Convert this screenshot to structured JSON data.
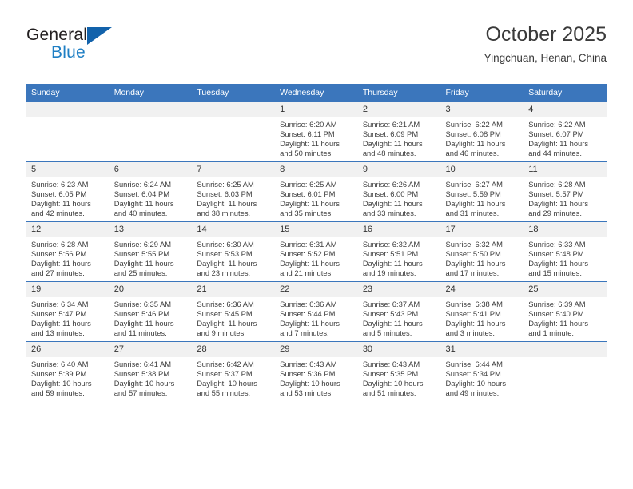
{
  "brand": {
    "name_part1": "General",
    "name_part2": "Blue",
    "triangle_color": "#1262AB",
    "blue_text_color": "#1F7FC4"
  },
  "header": {
    "title": "October 2025",
    "subtitle": "Yingchuan, Henan, China"
  },
  "theme": {
    "header_blue": "#3B76BC",
    "daynum_background": "#F1F1F1",
    "text_color": "#3D3D3D"
  },
  "weekday_headers": [
    "Sunday",
    "Monday",
    "Tuesday",
    "Wednesday",
    "Thursday",
    "Friday",
    "Saturday"
  ],
  "weeks": [
    [
      {
        "day": "",
        "sunrise": "",
        "sunset": "",
        "daylight_line1": "",
        "daylight_line2": ""
      },
      {
        "day": "",
        "sunrise": "",
        "sunset": "",
        "daylight_line1": "",
        "daylight_line2": ""
      },
      {
        "day": "",
        "sunrise": "",
        "sunset": "",
        "daylight_line1": "",
        "daylight_line2": ""
      },
      {
        "day": "1",
        "sunrise": "Sunrise: 6:20 AM",
        "sunset": "Sunset: 6:11 PM",
        "daylight_line1": "Daylight: 11 hours",
        "daylight_line2": "and 50 minutes."
      },
      {
        "day": "2",
        "sunrise": "Sunrise: 6:21 AM",
        "sunset": "Sunset: 6:09 PM",
        "daylight_line1": "Daylight: 11 hours",
        "daylight_line2": "and 48 minutes."
      },
      {
        "day": "3",
        "sunrise": "Sunrise: 6:22 AM",
        "sunset": "Sunset: 6:08 PM",
        "daylight_line1": "Daylight: 11 hours",
        "daylight_line2": "and 46 minutes."
      },
      {
        "day": "4",
        "sunrise": "Sunrise: 6:22 AM",
        "sunset": "Sunset: 6:07 PM",
        "daylight_line1": "Daylight: 11 hours",
        "daylight_line2": "and 44 minutes."
      }
    ],
    [
      {
        "day": "5",
        "sunrise": "Sunrise: 6:23 AM",
        "sunset": "Sunset: 6:05 PM",
        "daylight_line1": "Daylight: 11 hours",
        "daylight_line2": "and 42 minutes."
      },
      {
        "day": "6",
        "sunrise": "Sunrise: 6:24 AM",
        "sunset": "Sunset: 6:04 PM",
        "daylight_line1": "Daylight: 11 hours",
        "daylight_line2": "and 40 minutes."
      },
      {
        "day": "7",
        "sunrise": "Sunrise: 6:25 AM",
        "sunset": "Sunset: 6:03 PM",
        "daylight_line1": "Daylight: 11 hours",
        "daylight_line2": "and 38 minutes."
      },
      {
        "day": "8",
        "sunrise": "Sunrise: 6:25 AM",
        "sunset": "Sunset: 6:01 PM",
        "daylight_line1": "Daylight: 11 hours",
        "daylight_line2": "and 35 minutes."
      },
      {
        "day": "9",
        "sunrise": "Sunrise: 6:26 AM",
        "sunset": "Sunset: 6:00 PM",
        "daylight_line1": "Daylight: 11 hours",
        "daylight_line2": "and 33 minutes."
      },
      {
        "day": "10",
        "sunrise": "Sunrise: 6:27 AM",
        "sunset": "Sunset: 5:59 PM",
        "daylight_line1": "Daylight: 11 hours",
        "daylight_line2": "and 31 minutes."
      },
      {
        "day": "11",
        "sunrise": "Sunrise: 6:28 AM",
        "sunset": "Sunset: 5:57 PM",
        "daylight_line1": "Daylight: 11 hours",
        "daylight_line2": "and 29 minutes."
      }
    ],
    [
      {
        "day": "12",
        "sunrise": "Sunrise: 6:28 AM",
        "sunset": "Sunset: 5:56 PM",
        "daylight_line1": "Daylight: 11 hours",
        "daylight_line2": "and 27 minutes."
      },
      {
        "day": "13",
        "sunrise": "Sunrise: 6:29 AM",
        "sunset": "Sunset: 5:55 PM",
        "daylight_line1": "Daylight: 11 hours",
        "daylight_line2": "and 25 minutes."
      },
      {
        "day": "14",
        "sunrise": "Sunrise: 6:30 AM",
        "sunset": "Sunset: 5:53 PM",
        "daylight_line1": "Daylight: 11 hours",
        "daylight_line2": "and 23 minutes."
      },
      {
        "day": "15",
        "sunrise": "Sunrise: 6:31 AM",
        "sunset": "Sunset: 5:52 PM",
        "daylight_line1": "Daylight: 11 hours",
        "daylight_line2": "and 21 minutes."
      },
      {
        "day": "16",
        "sunrise": "Sunrise: 6:32 AM",
        "sunset": "Sunset: 5:51 PM",
        "daylight_line1": "Daylight: 11 hours",
        "daylight_line2": "and 19 minutes."
      },
      {
        "day": "17",
        "sunrise": "Sunrise: 6:32 AM",
        "sunset": "Sunset: 5:50 PM",
        "daylight_line1": "Daylight: 11 hours",
        "daylight_line2": "and 17 minutes."
      },
      {
        "day": "18",
        "sunrise": "Sunrise: 6:33 AM",
        "sunset": "Sunset: 5:48 PM",
        "daylight_line1": "Daylight: 11 hours",
        "daylight_line2": "and 15 minutes."
      }
    ],
    [
      {
        "day": "19",
        "sunrise": "Sunrise: 6:34 AM",
        "sunset": "Sunset: 5:47 PM",
        "daylight_line1": "Daylight: 11 hours",
        "daylight_line2": "and 13 minutes."
      },
      {
        "day": "20",
        "sunrise": "Sunrise: 6:35 AM",
        "sunset": "Sunset: 5:46 PM",
        "daylight_line1": "Daylight: 11 hours",
        "daylight_line2": "and 11 minutes."
      },
      {
        "day": "21",
        "sunrise": "Sunrise: 6:36 AM",
        "sunset": "Sunset: 5:45 PM",
        "daylight_line1": "Daylight: 11 hours",
        "daylight_line2": "and 9 minutes."
      },
      {
        "day": "22",
        "sunrise": "Sunrise: 6:36 AM",
        "sunset": "Sunset: 5:44 PM",
        "daylight_line1": "Daylight: 11 hours",
        "daylight_line2": "and 7 minutes."
      },
      {
        "day": "23",
        "sunrise": "Sunrise: 6:37 AM",
        "sunset": "Sunset: 5:43 PM",
        "daylight_line1": "Daylight: 11 hours",
        "daylight_line2": "and 5 minutes."
      },
      {
        "day": "24",
        "sunrise": "Sunrise: 6:38 AM",
        "sunset": "Sunset: 5:41 PM",
        "daylight_line1": "Daylight: 11 hours",
        "daylight_line2": "and 3 minutes."
      },
      {
        "day": "25",
        "sunrise": "Sunrise: 6:39 AM",
        "sunset": "Sunset: 5:40 PM",
        "daylight_line1": "Daylight: 11 hours",
        "daylight_line2": "and 1 minute."
      }
    ],
    [
      {
        "day": "26",
        "sunrise": "Sunrise: 6:40 AM",
        "sunset": "Sunset: 5:39 PM",
        "daylight_line1": "Daylight: 10 hours",
        "daylight_line2": "and 59 minutes."
      },
      {
        "day": "27",
        "sunrise": "Sunrise: 6:41 AM",
        "sunset": "Sunset: 5:38 PM",
        "daylight_line1": "Daylight: 10 hours",
        "daylight_line2": "and 57 minutes."
      },
      {
        "day": "28",
        "sunrise": "Sunrise: 6:42 AM",
        "sunset": "Sunset: 5:37 PM",
        "daylight_line1": "Daylight: 10 hours",
        "daylight_line2": "and 55 minutes."
      },
      {
        "day": "29",
        "sunrise": "Sunrise: 6:43 AM",
        "sunset": "Sunset: 5:36 PM",
        "daylight_line1": "Daylight: 10 hours",
        "daylight_line2": "and 53 minutes."
      },
      {
        "day": "30",
        "sunrise": "Sunrise: 6:43 AM",
        "sunset": "Sunset: 5:35 PM",
        "daylight_line1": "Daylight: 10 hours",
        "daylight_line2": "and 51 minutes."
      },
      {
        "day": "31",
        "sunrise": "Sunrise: 6:44 AM",
        "sunset": "Sunset: 5:34 PM",
        "daylight_line1": "Daylight: 10 hours",
        "daylight_line2": "and 49 minutes."
      },
      {
        "day": "",
        "sunrise": "",
        "sunset": "",
        "daylight_line1": "",
        "daylight_line2": ""
      }
    ]
  ]
}
